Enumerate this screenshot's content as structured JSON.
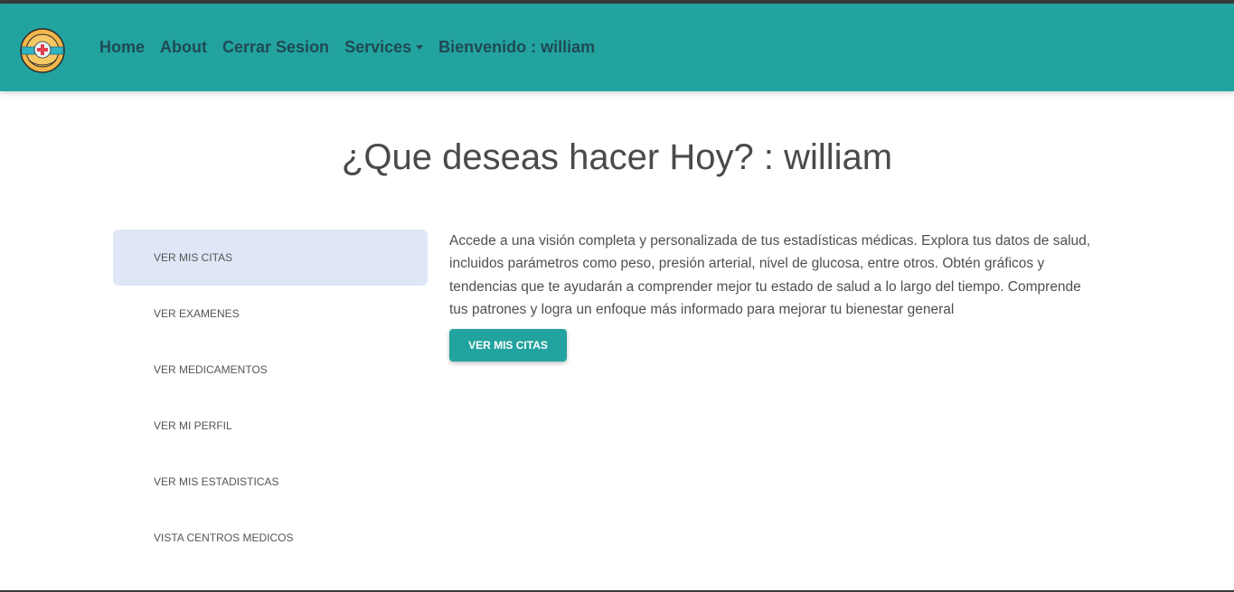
{
  "navbar": {
    "logo_icon": "healthy-hearts-logo",
    "links": {
      "home": "Home",
      "about": "About",
      "logout": "Cerrar Sesion",
      "services": "Services"
    },
    "welcome_prefix": "Bienvenido : ",
    "username": "william",
    "colors": {
      "background": "#22a39f",
      "link": "#1f4a54"
    }
  },
  "main": {
    "title": "¿Que deseas hacer Hoy? : william"
  },
  "sidebar": {
    "items": [
      {
        "label": "VER MIS CITAS",
        "active": true
      },
      {
        "label": "VER EXAMENES",
        "active": false
      },
      {
        "label": "VER MEDICAMENTOS",
        "active": false
      },
      {
        "label": "VER MI PERFIL",
        "active": false
      },
      {
        "label": "VER MIS ESTADISTICAS",
        "active": false
      },
      {
        "label": "VISTA CENTROS MEDICOS",
        "active": false
      }
    ],
    "active_color": "#dfe7f6"
  },
  "content": {
    "description": "Accede a una visión completa y personalizada de tus estadísticas médicas. Explora tus datos de salud, incluidos parámetros como peso, presión arterial, nivel de glucosa, entre otros. Obtén gráficos y tendencias que te ayudarán a comprender mejor tu estado de salud a lo largo del tiempo. Comprende tus patrones y logra un enfoque más informado para mejorar tu bienestar general",
    "button_label": "VER MIS CITAS",
    "accent": "#22a39f"
  }
}
